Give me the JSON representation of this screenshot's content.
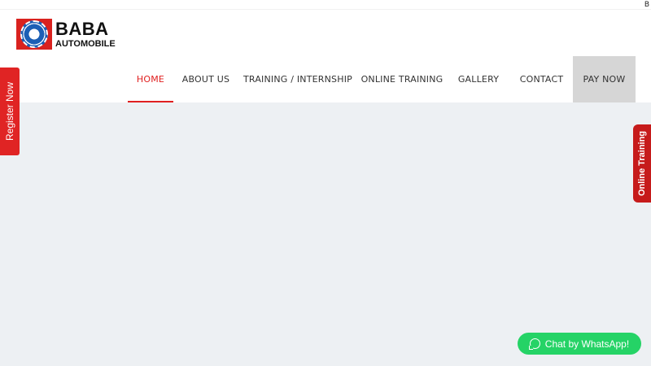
{
  "topbar": {
    "corner_text": "B"
  },
  "logo": {
    "title": "BABA",
    "subtitle": "AUTOMOBILE",
    "badge_icon": "gear-icon",
    "brand_color": "#d9221f"
  },
  "nav": {
    "items": [
      {
        "label": "HOME",
        "active": true
      },
      {
        "label": "ABOUT US",
        "active": false
      },
      {
        "label": "TRAINING / INTERNSHIP",
        "active": false
      },
      {
        "label": "ONLINE TRAINING",
        "active": false
      },
      {
        "label": "GALLERY",
        "active": false
      },
      {
        "label": "CONTACT",
        "active": false
      },
      {
        "label": "PAY NOW",
        "active": false
      }
    ],
    "accent_color": "#e02020"
  },
  "side_tabs": {
    "register": "Register Now",
    "online_training": "Online Training"
  },
  "whatsapp": {
    "label": "Chat by WhatsApp!",
    "icon": "whatsapp-icon",
    "color": "#25d366"
  }
}
